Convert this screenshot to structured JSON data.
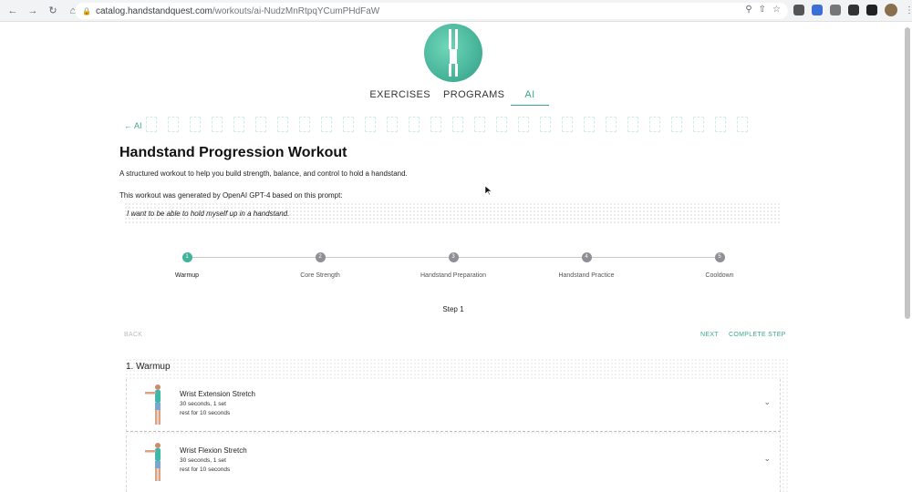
{
  "browser": {
    "url_host": "catalog.handstandquest.com",
    "url_path": "/workouts/ai-NudzMnRtpqYCumPHdFaW",
    "back_glyph": "←",
    "forward_glyph": "→",
    "reload_glyph": "↻",
    "home_glyph": "⌂"
  },
  "nav": {
    "exercises": "EXERCISES",
    "programs": "PROGRAMS",
    "ai": "AI"
  },
  "breadcrumb": {
    "back_label": "← AI"
  },
  "workout": {
    "title": "Handstand Progression Workout",
    "description": "A structured workout to help you build strength, balance, and control to hold a handstand.",
    "generated_note": "This workout was generated by OpenAI GPT-4 based on this prompt:",
    "prompt": "I want to be able to hold myself up in a handstand."
  },
  "stepper": {
    "steps": [
      {
        "number": "1",
        "label": "Warmup",
        "active": true
      },
      {
        "number": "2",
        "label": "Core Strength",
        "active": false
      },
      {
        "number": "3",
        "label": "Handstand Preparation",
        "active": false
      },
      {
        "number": "4",
        "label": "Handstand Practice",
        "active": false
      },
      {
        "number": "5",
        "label": "Cooldown",
        "active": false
      }
    ],
    "caption": "Step 1"
  },
  "controls": {
    "back": "BACK",
    "next": "NEXT",
    "complete": "COMPLETE STEP"
  },
  "section": {
    "title": "1. Warmup",
    "exercises": [
      {
        "name": "Wrist Extension Stretch",
        "detail": "30 seconds, 1 set",
        "rest": "rest for 10 seconds"
      },
      {
        "name": "Wrist Flexion Stretch",
        "detail": "30 seconds, 1 set",
        "rest": "rest for 10 seconds"
      }
    ]
  },
  "colors": {
    "accent": "#3aa88d",
    "step_active": "#41b39a",
    "step_inactive": "#8f8f96"
  }
}
